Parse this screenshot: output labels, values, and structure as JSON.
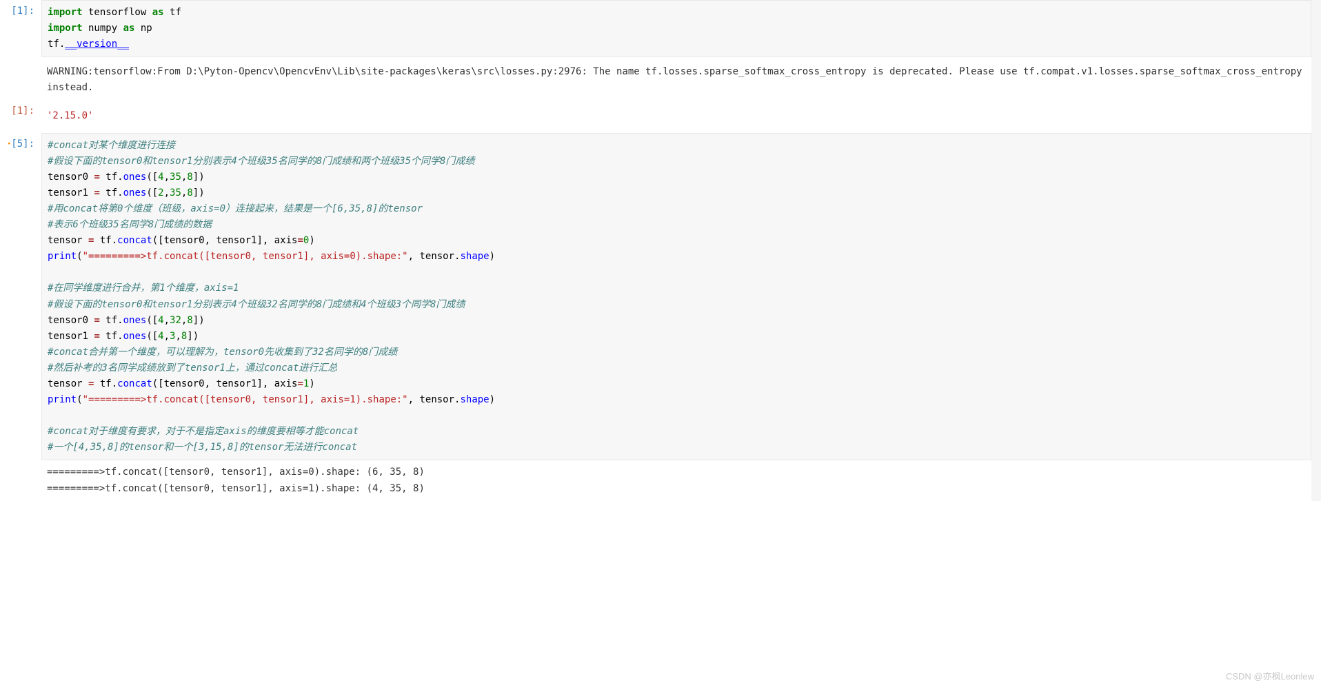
{
  "cells": {
    "c1": {
      "prompt": "[1]: ",
      "lines": {
        "l0": {
          "kw1": "import",
          "nm1": " tensorflow ",
          "kw2": "as",
          "nm2": " tf"
        },
        "l1": {
          "kw1": "import",
          "nm1": " numpy ",
          "kw2": "as",
          "nm2": " np"
        },
        "l2": "",
        "l3": {
          "p1": "tf.",
          "attr": "__version__"
        }
      }
    },
    "c1out": {
      "warn": "WARNING:tensorflow:From D:\\Pyton-Opencv\\OpencvEnv\\Lib\\site-packages\\keras\\src\\losses.py:2976: The name tf.losses.sparse_softmax_cross_entropy is deprecated. Please use tf.compat.v1.losses.sparse_softmax_cross_entropy instead."
    },
    "c1res": {
      "prompt": "[1]: ",
      "value": "'2.15.0'"
    },
    "c5": {
      "prompt": "[5]: ",
      "mod": "•",
      "lines": {
        "l0": "#concat对某个维度进行连接",
        "l1": "#假设下面的tensor0和tensor1分别表示4个班级35名同学的8门成绩和两个班级35个同学8门成绩",
        "l2a": "tensor0 ",
        "l2b": "=",
        "l2c": " tf.",
        "l2d": "ones",
        "l2e": "([",
        "l2f": "4",
        "l2g": ",",
        "l2h": "35",
        "l2i": ",",
        "l2j": "8",
        "l2k": "])",
        "l3a": "tensor1 ",
        "l3b": "=",
        "l3c": " tf.",
        "l3d": "ones",
        "l3e": "([",
        "l3f": "2",
        "l3g": ",",
        "l3h": "35",
        "l3i": ",",
        "l3j": "8",
        "l3k": "])",
        "l4": "#用concat将第0个维度（班级，axis=0）连接起来，结果是一个[6,35,8]的tensor",
        "l5": "#表示6个班级35名同学8门成绩的数据",
        "l6a": "tensor ",
        "l6b": "=",
        "l6c": " tf.",
        "l6d": "concat",
        "l6e": "([tensor0, tensor1], axis",
        "l6f": "=",
        "l6g": "0",
        "l6h": ")",
        "l7a": "print",
        "l7b": "(",
        "l7c": "\"=========>tf.concat([tensor0, tensor1], axis=0).shape:\"",
        "l7d": ", tensor.",
        "l7e": "shape",
        "l7f": ")",
        "l8": "",
        "l9": "#在同学维度进行合并，第1个维度，axis=1",
        "l10": "#假设下面的tensor0和tensor1分别表示4个班级32名同学的8门成绩和4个班级3个同学8门成绩",
        "l11a": "tensor0 ",
        "l11b": "=",
        "l11c": " tf.",
        "l11d": "ones",
        "l11e": "([",
        "l11f": "4",
        "l11g": ",",
        "l11h": "32",
        "l11i": ",",
        "l11j": "8",
        "l11k": "])",
        "l12a": "tensor1 ",
        "l12b": "=",
        "l12c": " tf.",
        "l12d": "ones",
        "l12e": "([",
        "l12f": "4",
        "l12g": ",",
        "l12h": "3",
        "l12i": ",",
        "l12j": "8",
        "l12k": "])",
        "l13": "#concat合并第一个维度，可以理解为，tensor0先收集到了32名同学的8门成绩",
        "l14": "#然后补考的3名同学成绩放到了tensor1上，通过concat进行汇总",
        "l15a": "tensor ",
        "l15b": "=",
        "l15c": " tf.",
        "l15d": "concat",
        "l15e": "([tensor0, tensor1], axis",
        "l15f": "=",
        "l15g": "1",
        "l15h": ")",
        "l16a": "print",
        "l16b": "(",
        "l16c": "\"=========>tf.concat([tensor0, tensor1], axis=1).shape:\"",
        "l16d": ", tensor.",
        "l16e": "shape",
        "l16f": ")",
        "l17": "",
        "l18": "#concat对于维度有要求，对于不是指定axis的维度要相等才能concat",
        "l19": "#一个[4,35,8]的tensor和一个[3,15,8]的tensor无法进行concat"
      }
    },
    "c5out": {
      "l1": "=========>tf.concat([tensor0, tensor1], axis=0).shape: (6, 35, 8)",
      "l2": "=========>tf.concat([tensor0, tensor1], axis=1).shape: (4, 35, 8)"
    }
  },
  "watermark": "CSDN @亦枫Leonlew"
}
